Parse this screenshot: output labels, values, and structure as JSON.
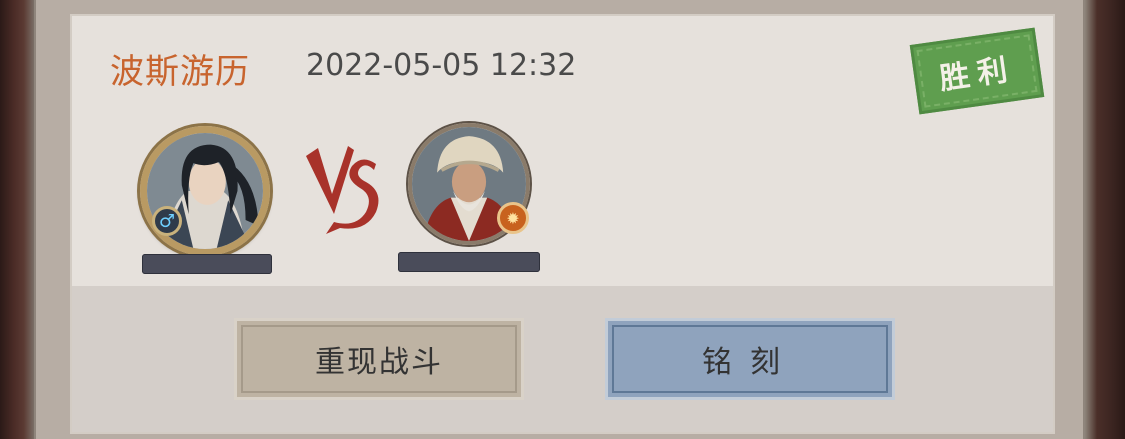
{
  "battle": {
    "title": "波斯游历",
    "datetime": "2022-05-05 12:32",
    "result": "胜利"
  },
  "players": [
    {
      "name_visible": "",
      "gender_icon": "male-icon"
    },
    {
      "name_visible": "",
      "emblem_icon": "fire-emblem-icon"
    }
  ],
  "icons": {
    "vs": "vs-icon",
    "male": "♂"
  },
  "actions": {
    "replay_label": "重现战斗",
    "engrave_label": "铭刻"
  },
  "colors": {
    "title": "#c8642e",
    "victory_stamp": "#5f9e4f",
    "replay_button": "#beb3a3",
    "engrave_button": "#8fa3bd"
  }
}
